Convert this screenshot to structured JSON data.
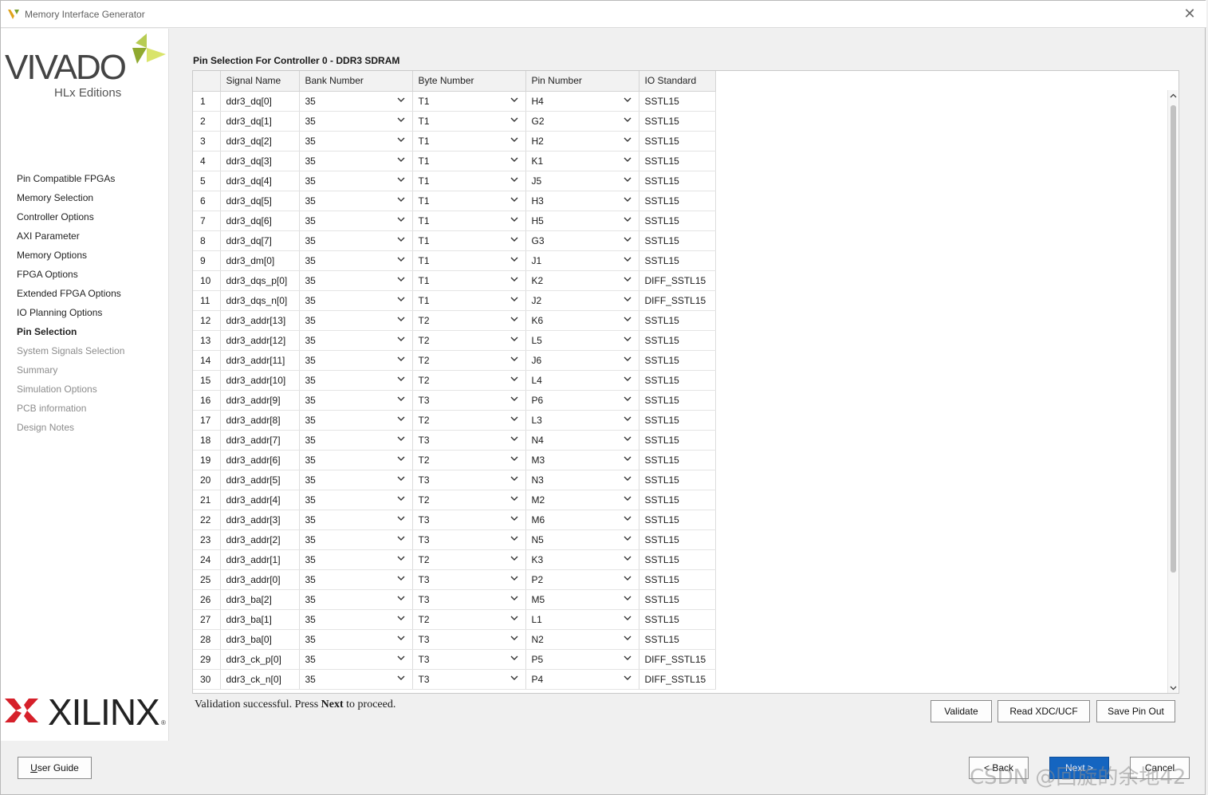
{
  "window": {
    "title": "Memory Interface Generator",
    "close_glyph": "✕"
  },
  "sidebar": {
    "logo_text": "VIVADO",
    "logo_sub": "HLx Editions",
    "steps": [
      {
        "label": "Pin Compatible FPGAs",
        "state": "done"
      },
      {
        "label": "Memory Selection",
        "state": "done"
      },
      {
        "label": "Controller Options",
        "state": "done"
      },
      {
        "label": "AXI Parameter",
        "state": "done"
      },
      {
        "label": "Memory Options",
        "state": "done"
      },
      {
        "label": "FPGA Options",
        "state": "done"
      },
      {
        "label": "Extended FPGA Options",
        "state": "done"
      },
      {
        "label": "IO Planning Options",
        "state": "done"
      },
      {
        "label": "Pin Selection",
        "state": "active"
      },
      {
        "label": "System Signals Selection",
        "state": "disabled"
      },
      {
        "label": "Summary",
        "state": "disabled"
      },
      {
        "label": "Simulation Options",
        "state": "disabled"
      },
      {
        "label": "PCB information",
        "state": "disabled"
      },
      {
        "label": "Design Notes",
        "state": "disabled"
      }
    ],
    "brand": "XILINX",
    "brand_mark": "®"
  },
  "main": {
    "title": "Pin Selection For Controller 0 - DDR3 SDRAM",
    "columns": [
      "",
      "Signal Name",
      "Bank Number",
      "Byte Number",
      "Pin Number",
      "IO Standard"
    ],
    "rows": [
      {
        "n": "1",
        "signal": "ddr3_dq[0]",
        "bank": "35",
        "byte": "T1",
        "pin": "H4",
        "io": "SSTL15"
      },
      {
        "n": "2",
        "signal": "ddr3_dq[1]",
        "bank": "35",
        "byte": "T1",
        "pin": "G2",
        "io": "SSTL15"
      },
      {
        "n": "3",
        "signal": "ddr3_dq[2]",
        "bank": "35",
        "byte": "T1",
        "pin": "H2",
        "io": "SSTL15"
      },
      {
        "n": "4",
        "signal": "ddr3_dq[3]",
        "bank": "35",
        "byte": "T1",
        "pin": "K1",
        "io": "SSTL15"
      },
      {
        "n": "5",
        "signal": "ddr3_dq[4]",
        "bank": "35",
        "byte": "T1",
        "pin": "J5",
        "io": "SSTL15"
      },
      {
        "n": "6",
        "signal": "ddr3_dq[5]",
        "bank": "35",
        "byte": "T1",
        "pin": "H3",
        "io": "SSTL15"
      },
      {
        "n": "7",
        "signal": "ddr3_dq[6]",
        "bank": "35",
        "byte": "T1",
        "pin": "H5",
        "io": "SSTL15"
      },
      {
        "n": "8",
        "signal": "ddr3_dq[7]",
        "bank": "35",
        "byte": "T1",
        "pin": "G3",
        "io": "SSTL15"
      },
      {
        "n": "9",
        "signal": "ddr3_dm[0]",
        "bank": "35",
        "byte": "T1",
        "pin": "J1",
        "io": "SSTL15"
      },
      {
        "n": "10",
        "signal": "ddr3_dqs_p[0]",
        "bank": "35",
        "byte": "T1",
        "pin": "K2",
        "io": "DIFF_SSTL15"
      },
      {
        "n": "11",
        "signal": "ddr3_dqs_n[0]",
        "bank": "35",
        "byte": "T1",
        "pin": "J2",
        "io": "DIFF_SSTL15"
      },
      {
        "n": "12",
        "signal": "ddr3_addr[13]",
        "bank": "35",
        "byte": "T2",
        "pin": "K6",
        "io": "SSTL15"
      },
      {
        "n": "13",
        "signal": "ddr3_addr[12]",
        "bank": "35",
        "byte": "T2",
        "pin": "L5",
        "io": "SSTL15"
      },
      {
        "n": "14",
        "signal": "ddr3_addr[11]",
        "bank": "35",
        "byte": "T2",
        "pin": "J6",
        "io": "SSTL15"
      },
      {
        "n": "15",
        "signal": "ddr3_addr[10]",
        "bank": "35",
        "byte": "T2",
        "pin": "L4",
        "io": "SSTL15"
      },
      {
        "n": "16",
        "signal": "ddr3_addr[9]",
        "bank": "35",
        "byte": "T3",
        "pin": "P6",
        "io": "SSTL15"
      },
      {
        "n": "17",
        "signal": "ddr3_addr[8]",
        "bank": "35",
        "byte": "T2",
        "pin": "L3",
        "io": "SSTL15"
      },
      {
        "n": "18",
        "signal": "ddr3_addr[7]",
        "bank": "35",
        "byte": "T3",
        "pin": "N4",
        "io": "SSTL15"
      },
      {
        "n": "19",
        "signal": "ddr3_addr[6]",
        "bank": "35",
        "byte": "T2",
        "pin": "M3",
        "io": "SSTL15"
      },
      {
        "n": "20",
        "signal": "ddr3_addr[5]",
        "bank": "35",
        "byte": "T3",
        "pin": "N3",
        "io": "SSTL15"
      },
      {
        "n": "21",
        "signal": "ddr3_addr[4]",
        "bank": "35",
        "byte": "T2",
        "pin": "M2",
        "io": "SSTL15"
      },
      {
        "n": "22",
        "signal": "ddr3_addr[3]",
        "bank": "35",
        "byte": "T3",
        "pin": "M6",
        "io": "SSTL15"
      },
      {
        "n": "23",
        "signal": "ddr3_addr[2]",
        "bank": "35",
        "byte": "T3",
        "pin": "N5",
        "io": "SSTL15"
      },
      {
        "n": "24",
        "signal": "ddr3_addr[1]",
        "bank": "35",
        "byte": "T2",
        "pin": "K3",
        "io": "SSTL15"
      },
      {
        "n": "25",
        "signal": "ddr3_addr[0]",
        "bank": "35",
        "byte": "T3",
        "pin": "P2",
        "io": "SSTL15"
      },
      {
        "n": "26",
        "signal": "ddr3_ba[2]",
        "bank": "35",
        "byte": "T3",
        "pin": "M5",
        "io": "SSTL15"
      },
      {
        "n": "27",
        "signal": "ddr3_ba[1]",
        "bank": "35",
        "byte": "T2",
        "pin": "L1",
        "io": "SSTL15"
      },
      {
        "n": "28",
        "signal": "ddr3_ba[0]",
        "bank": "35",
        "byte": "T3",
        "pin": "N2",
        "io": "SSTL15"
      },
      {
        "n": "29",
        "signal": "ddr3_ck_p[0]",
        "bank": "35",
        "byte": "T3",
        "pin": "P5",
        "io": "DIFF_SSTL15"
      },
      {
        "n": "30",
        "signal": "ddr3_ck_n[0]",
        "bank": "35",
        "byte": "T3",
        "pin": "P4",
        "io": "DIFF_SSTL15"
      }
    ],
    "status_prefix": "Validation successful. Press ",
    "status_bold": "Next",
    "status_suffix": " to proceed.",
    "actions": {
      "validate": "Validate",
      "read_xdc": "Read XDC/UCF",
      "save_pin_out": "Save Pin Out"
    }
  },
  "footer": {
    "user_guide_first": "U",
    "user_guide_rest": "ser Guide",
    "back": "< Back",
    "next": "Next >",
    "cancel": "Cancel",
    "watermark": "CSDN @回旋的余地42"
  },
  "colors": {
    "vivado_logo_green": "#a9c23f",
    "xilinx_red": "#d6202a",
    "next_blue": "#1565c0"
  }
}
